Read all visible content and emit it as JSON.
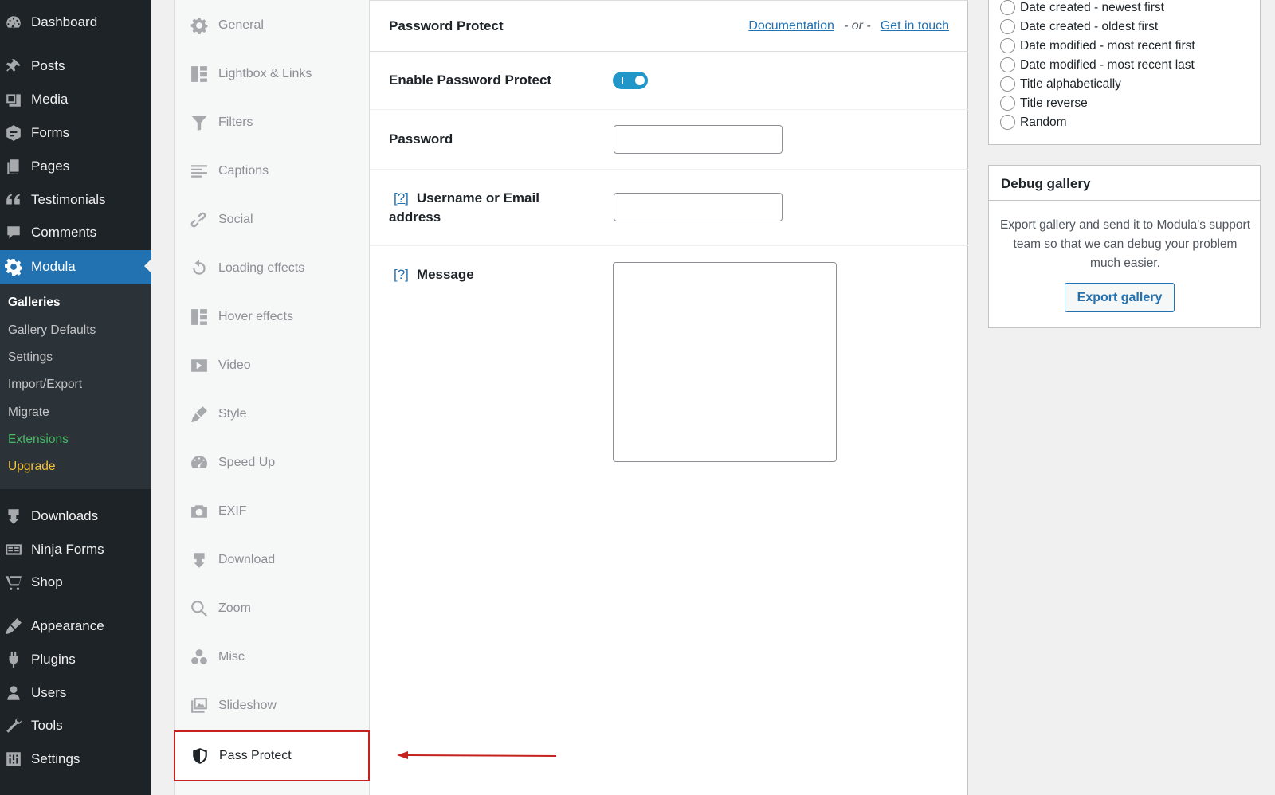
{
  "admin_menu": {
    "items": [
      {
        "label": "Dashboard",
        "icon": "dashboard-icon"
      },
      {
        "label": "Posts",
        "icon": "pin-icon"
      },
      {
        "label": "Media",
        "icon": "media-icon"
      },
      {
        "label": "Forms",
        "icon": "forms-icon"
      },
      {
        "label": "Pages",
        "icon": "pages-icon"
      },
      {
        "label": "Testimonials",
        "icon": "quote-icon"
      },
      {
        "label": "Comments",
        "icon": "comments-icon"
      },
      {
        "label": "Modula",
        "icon": "gear-icon"
      },
      {
        "label": "Downloads",
        "icon": "download-icon"
      },
      {
        "label": "Ninja Forms",
        "icon": "ninja-forms-icon"
      },
      {
        "label": "Shop",
        "icon": "cart-icon"
      },
      {
        "label": "Appearance",
        "icon": "brush-icon"
      },
      {
        "label": "Plugins",
        "icon": "plugin-icon"
      },
      {
        "label": "Users",
        "icon": "user-icon"
      },
      {
        "label": "Tools",
        "icon": "wrench-icon"
      },
      {
        "label": "Settings",
        "icon": "settings-icon"
      }
    ],
    "submenu": [
      "Galleries",
      "Gallery Defaults",
      "Settings",
      "Import/Export",
      "Migrate",
      "Extensions",
      "Upgrade"
    ]
  },
  "tabs": [
    {
      "label": "General",
      "icon": "gear-icon"
    },
    {
      "label": "Lightbox & Links",
      "icon": "grid-icon"
    },
    {
      "label": "Filters",
      "icon": "filter-icon"
    },
    {
      "label": "Captions",
      "icon": "captions-icon"
    },
    {
      "label": "Social",
      "icon": "link-icon"
    },
    {
      "label": "Loading effects",
      "icon": "refresh-icon"
    },
    {
      "label": "Hover effects",
      "icon": "grid-icon"
    },
    {
      "label": "Video",
      "icon": "play-icon"
    },
    {
      "label": "Style",
      "icon": "brush-icon"
    },
    {
      "label": "Speed Up",
      "icon": "speedometer-icon"
    },
    {
      "label": "EXIF",
      "icon": "camera-icon"
    },
    {
      "label": "Download",
      "icon": "download-icon"
    },
    {
      "label": "Zoom",
      "icon": "magnifier-icon"
    },
    {
      "label": "Misc",
      "icon": "circles-icon"
    },
    {
      "label": "Slideshow",
      "icon": "slideshow-icon"
    },
    {
      "label": "Pass Protect",
      "icon": "shield-icon"
    }
  ],
  "panel": {
    "title": "Password Protect",
    "doc_link": "Documentation",
    "or_text": "- or -",
    "contact_link": "Get in touch",
    "enable_label": "Enable Password Protect",
    "enable_on": true,
    "password_label": "Password",
    "password_value": "",
    "username_help": "[?]",
    "username_label": "Username or Email address",
    "username_value": "",
    "message_help": "[?]",
    "message_label": "Message",
    "message_value": ""
  },
  "sort_options": [
    "Date created - newest first",
    "Date created - oldest first",
    "Date modified - most recent first",
    "Date modified - most recent last",
    "Title alphabetically",
    "Title reverse",
    "Random"
  ],
  "debug": {
    "title": "Debug gallery",
    "text": "Export gallery and send it to Modula's support team so that we can debug your problem much easier.",
    "button": "Export gallery"
  },
  "colors": {
    "admin_bg": "#1d2327",
    "accent": "#2271b1",
    "toggle_on": "#2196c9",
    "annotation": "#c5221f"
  }
}
